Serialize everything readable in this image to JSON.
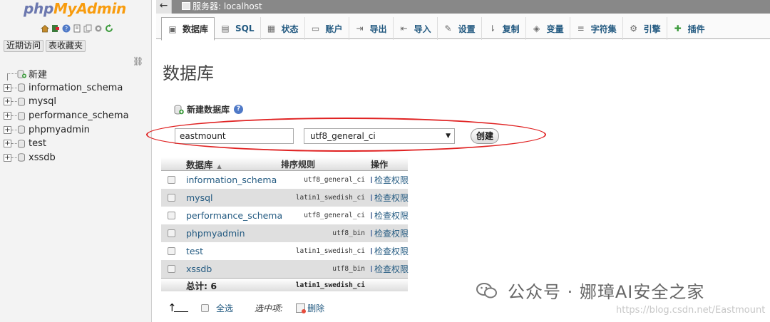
{
  "nav": {
    "logo_php": "php",
    "logo_myadmin": "MyAdmin",
    "tabs": [
      "近期访问",
      "表收藏夹"
    ],
    "new_label": "新建",
    "databases": [
      "information_schema",
      "mysql",
      "performance_schema",
      "phpmyadmin",
      "test",
      "xssdb"
    ]
  },
  "header": {
    "collapse": "←",
    "server_label": "服务器: localhost"
  },
  "menu": {
    "tabs": [
      {
        "label": "数据库",
        "icon": "database-icon"
      },
      {
        "label": "SQL",
        "icon": "sql-icon"
      },
      {
        "label": "状态",
        "icon": "status-icon"
      },
      {
        "label": "账户",
        "icon": "accounts-icon"
      },
      {
        "label": "导出",
        "icon": "export-icon"
      },
      {
        "label": "导入",
        "icon": "import-icon"
      },
      {
        "label": "设置",
        "icon": "settings-icon"
      },
      {
        "label": "复制",
        "icon": "replication-icon"
      },
      {
        "label": "变量",
        "icon": "variables-icon"
      },
      {
        "label": "字符集",
        "icon": "charset-icon"
      },
      {
        "label": "引擎",
        "icon": "engines-icon"
      },
      {
        "label": "插件",
        "icon": "plugins-icon"
      }
    ]
  },
  "main": {
    "title": "数据库",
    "create_label": "新建数据库",
    "db_name_value": "eastmount",
    "collation_value": "utf8_general_ci",
    "create_button": "创建",
    "table": {
      "headers": {
        "name": "数据库",
        "collation": "排序规则",
        "action": "操作"
      },
      "rows": [
        {
          "name": "information_schema",
          "collation": "utf8_general_ci",
          "action": "检查权限"
        },
        {
          "name": "mysql",
          "collation": "latin1_swedish_ci",
          "action": "检查权限"
        },
        {
          "name": "performance_schema",
          "collation": "utf8_general_ci",
          "action": "检查权限"
        },
        {
          "name": "phpmyadmin",
          "collation": "utf8_bin",
          "action": "检查权限"
        },
        {
          "name": "test",
          "collation": "latin1_swedish_ci",
          "action": "检查权限"
        },
        {
          "name": "xssdb",
          "collation": "utf8_bin",
          "action": "检查权限"
        }
      ],
      "footer": {
        "total": "总计: 6",
        "collation": "latin1_swedish_ci"
      }
    },
    "bottom": {
      "select_all": "全选",
      "with_selected": "选中项:",
      "delete": "删除"
    }
  },
  "watermark": {
    "text": "公众号 · 娜璋AI安全之家",
    "url": "https://blog.csdn.net/Eastmount"
  },
  "colors": {
    "link": "#235a81",
    "logo_php": "#6c78af",
    "logo_myadmin": "#f89c0e",
    "highlight": "#e02222"
  }
}
